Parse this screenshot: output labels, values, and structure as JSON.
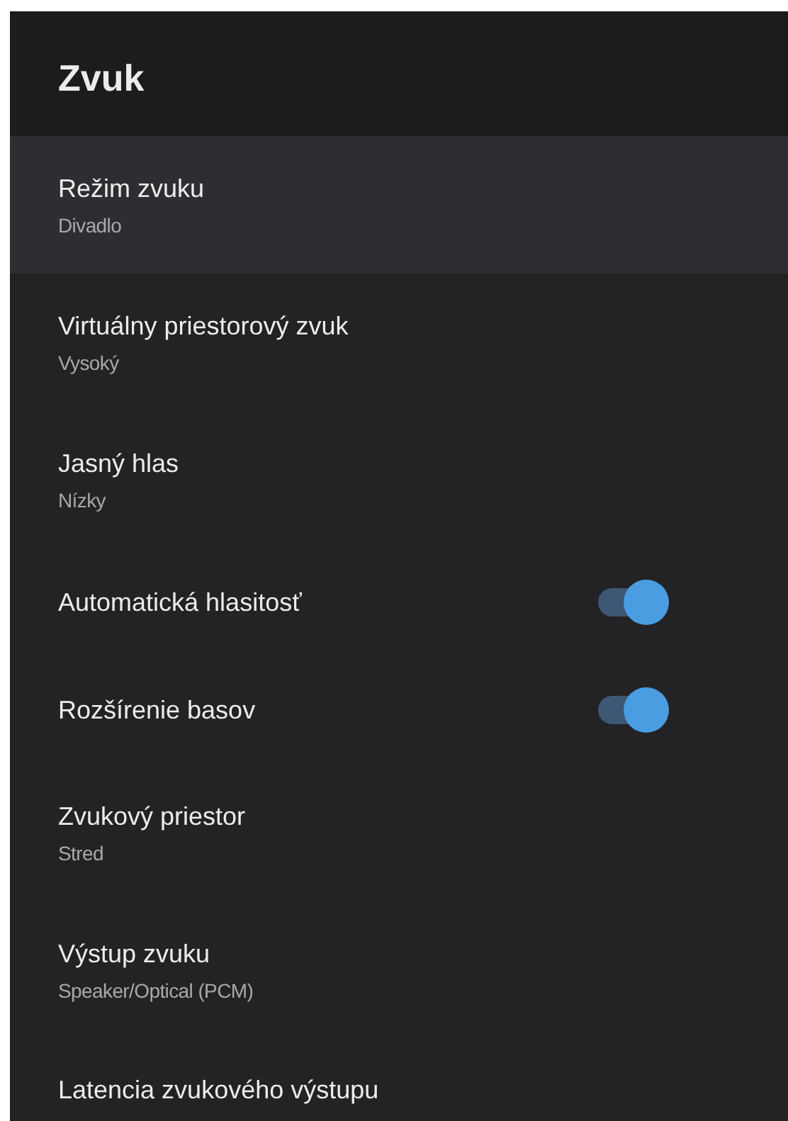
{
  "header": {
    "title": "Zvuk"
  },
  "items": [
    {
      "kind": "value",
      "title": "Režim zvuku",
      "value": "Divadlo",
      "selected": true
    },
    {
      "kind": "value",
      "title": "Virtuálny priestorový zvuk",
      "value": "Vysoký",
      "selected": false
    },
    {
      "kind": "value",
      "title": "Jasný hlas",
      "value": "Nízky",
      "selected": false
    },
    {
      "kind": "toggle",
      "title": "Automatická hlasitosť",
      "on": true,
      "selected": false
    },
    {
      "kind": "toggle",
      "title": "Rozšírenie basov",
      "on": true,
      "selected": false
    },
    {
      "kind": "value",
      "title": "Zvukový priestor",
      "value": "Stred",
      "selected": false
    },
    {
      "kind": "value",
      "title": "Výstup zvuku",
      "value": "Speaker/Optical (PCM)",
      "selected": false
    },
    {
      "kind": "plain",
      "title": "Latencia zvukového výstupu",
      "selected": false
    }
  ]
}
